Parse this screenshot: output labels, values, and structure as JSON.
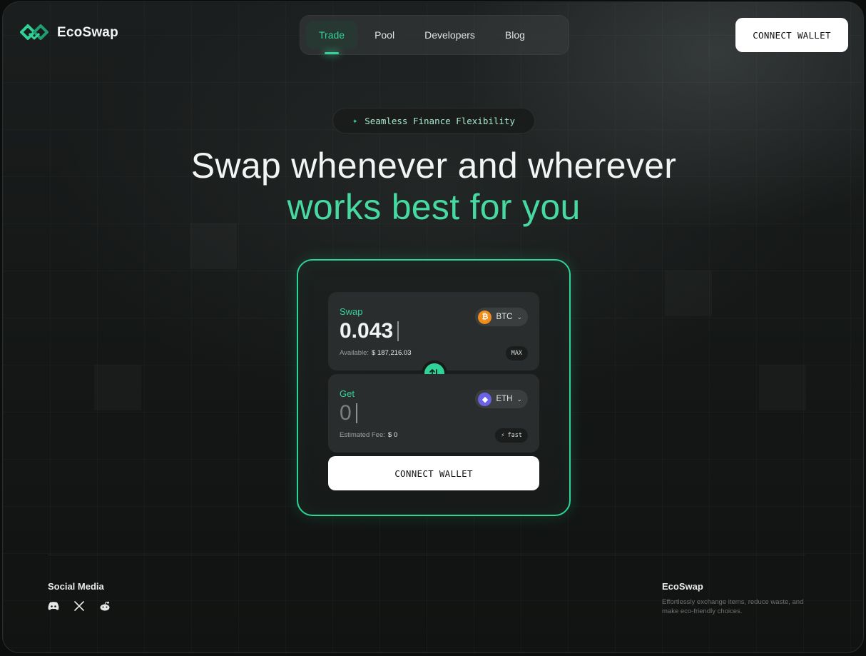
{
  "brand": {
    "name": "EcoSwap",
    "accent": "#34d399"
  },
  "nav": {
    "items": [
      {
        "label": "Trade",
        "active": true
      },
      {
        "label": "Pool",
        "active": false
      },
      {
        "label": "Developers",
        "active": false
      },
      {
        "label": "Blog",
        "active": false
      }
    ]
  },
  "header": {
    "connect_label": "CONNECT WALLET"
  },
  "hero": {
    "badge": "Seamless Finance Flexibility",
    "title_line1": "Swap whenever and wherever",
    "title_line2": "works best for you"
  },
  "swap": {
    "from": {
      "label": "Swap",
      "amount": "0.043",
      "token": "BTC",
      "available_label": "Available:",
      "available_value": "$ 187,216.03",
      "chip": "MAX"
    },
    "to": {
      "label": "Get",
      "amount": "0",
      "token": "ETH",
      "fee_label": "Estimated Fee:",
      "fee_value": "$ 0",
      "chip": "fast"
    },
    "connect_label": "CONNECT WALLET"
  },
  "footer": {
    "social_title": "Social Media",
    "social_icons": [
      "discord-icon",
      "x-icon",
      "reddit-icon"
    ],
    "brand": "EcoSwap",
    "description": "Effortlessly exchange items, reduce waste, and make eco-friendly choices."
  }
}
